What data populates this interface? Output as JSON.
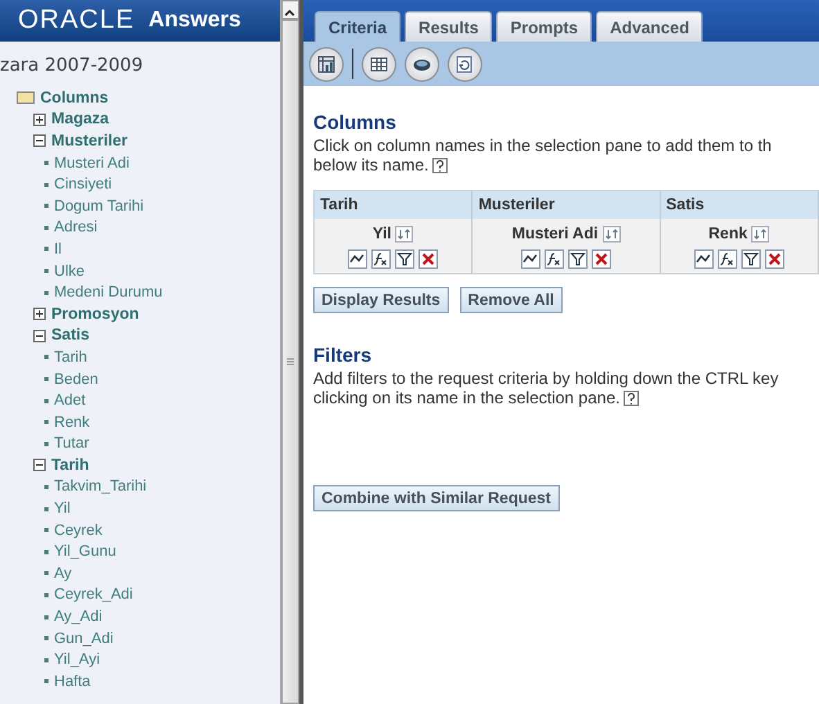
{
  "header": {
    "brand": "ORACLE",
    "product": "Answers"
  },
  "sidebar": {
    "subject_area": "zara 2007-2009",
    "tree": {
      "label": "Columns",
      "children": [
        {
          "label": "Magaza",
          "expanded": false
        },
        {
          "label": "Musteriler",
          "expanded": true,
          "children": [
            "Musteri Adi",
            "Cinsiyeti",
            "Dogum Tarihi",
            "Adresi",
            "Il",
            "Ulke",
            "Medeni Durumu"
          ]
        },
        {
          "label": "Promosyon",
          "expanded": false
        },
        {
          "label": "Satis",
          "expanded": true,
          "children": [
            "Tarih",
            "Beden",
            "Adet",
            "Renk",
            "Tutar"
          ]
        },
        {
          "label": "Tarih",
          "expanded": true,
          "children": [
            "Takvim_Tarihi",
            "Yil",
            "Ceyrek",
            "Yil_Gunu",
            "Ay",
            "Ceyrek_Adi",
            "Ay_Adi",
            "Gun_Adi",
            "Yil_Ayi",
            "Hafta"
          ]
        }
      ]
    }
  },
  "tabs": [
    {
      "label": "Criteria",
      "selected": true
    },
    {
      "label": "Results",
      "selected": false
    },
    {
      "label": "Prompts",
      "selected": false
    },
    {
      "label": "Advanced",
      "selected": false
    }
  ],
  "columns_section": {
    "title": "Columns",
    "text": "Click on column names in the selection pane to add them to th",
    "text_2": "below its name."
  },
  "criteria_table": [
    {
      "folder": "Tarih",
      "column": "Yil"
    },
    {
      "folder": "Musteriler",
      "column": "Musteri Adi"
    },
    {
      "folder": "Satis",
      "column": "Renk"
    }
  ],
  "buttons": [
    "Display Results",
    "Remove All"
  ],
  "filters_section": {
    "title": "Filters",
    "text": "Add filters to the request criteria by holding down the CTRL key",
    "text_2": "clicking on its name in the selection pane."
  },
  "combine_button": "Combine with Similar Request"
}
